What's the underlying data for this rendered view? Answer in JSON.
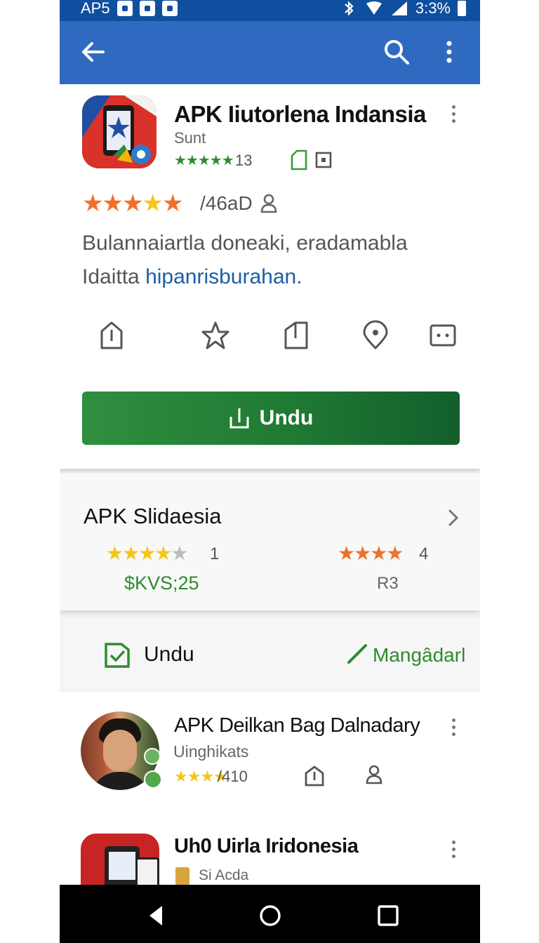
{
  "status_bar": {
    "carrier": "AP5",
    "time": "3:3%"
  },
  "toolbar": {
    "back_icon": "back-arrow-icon",
    "search_icon": "search-icon",
    "more_icon": "more-vert-icon"
  },
  "app": {
    "title": "APK Iiutorlena Indansia",
    "developer": "Sunt",
    "small_stars": "★★★★★",
    "small_rating_count": "13",
    "rating_stars_count": 5,
    "review_count": "/46aD",
    "description_line1": "Bulannaiartla doneaki, eradamabla",
    "description_line2_plain": "Idaitta ",
    "description_line2_link": "hipanrisburahan.",
    "download_label": "Undu"
  },
  "related": {
    "title": "APK Slidaesia",
    "left_stars": "★★★★",
    "left_star_empty": "★",
    "left_count": "1",
    "left_price": "$KVS;25",
    "right_stars": "★★★★",
    "right_count": "4",
    "right_price": "R3"
  },
  "section": {
    "left_label": "Undu",
    "right_label": "Mangâdarl"
  },
  "list": [
    {
      "title": "APK Deilkan  Bag Dalnadary",
      "subtitle": "Uinghikats",
      "stars": "★★★★",
      "meta": "/410"
    },
    {
      "title": "Uh0 Uirla  Iridonesia",
      "subtitle": "Si Acda"
    }
  ],
  "colors": {
    "appbar": "#2e6bc0",
    "status": "#0f4fa0",
    "accent_green": "#1f7a33",
    "star_orange": "#f2702a",
    "star_yellow": "#f5c518"
  }
}
